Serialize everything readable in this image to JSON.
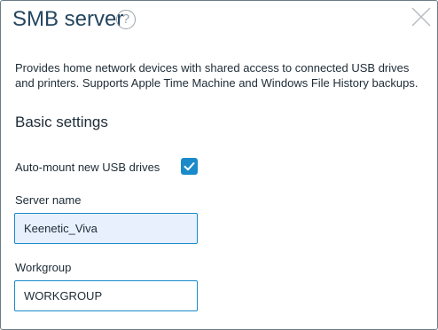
{
  "dialog": {
    "title": "SMB server",
    "help_icon": "question-mark-icon",
    "help_glyph": "?",
    "close_icon": "close-icon",
    "description": "Provides home network devices with shared access to connected USB drives and printers. Supports Apple Time Machine and Windows File History backups."
  },
  "basic_settings": {
    "title": "Basic settings",
    "auto_mount": {
      "label": "Auto-mount new USB drives",
      "checked": true
    },
    "server_name": {
      "label": "Server name",
      "value": "Keenetic_Viva"
    },
    "workgroup": {
      "label": "Workgroup",
      "value": "WORKGROUP"
    }
  },
  "colors": {
    "accent": "#1a8ac9",
    "title": "#24465f",
    "autofill_background": "#e8f0fe"
  }
}
